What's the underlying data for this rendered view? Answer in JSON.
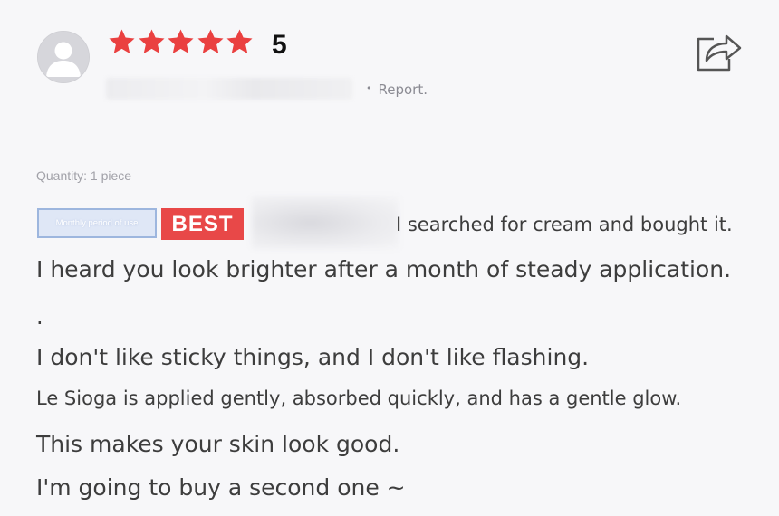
{
  "review": {
    "rating": "5",
    "stars": 5,
    "report_label": "Report.",
    "quantity": "Quantity: 1 piece",
    "period_badge": "Monthly period of use",
    "best_badge": "BEST",
    "lines": [
      "I searched for cream and bought it.",
      "I heard you look brighter after a month of steady application.",
      ".",
      "I don't like sticky things, and I don't like flashing.",
      "Le Sioga is applied gently, absorbed quickly, and has a gentle glow.",
      "This makes your skin look good.",
      "I'm going to buy a second one ~"
    ]
  },
  "icons": {
    "avatar": "default-user-avatar-icon",
    "star": "star-icon",
    "share": "share-icon"
  },
  "colors": {
    "star": "#ea4040",
    "best_badge": "#e84848",
    "period_badge_border": "#9db6de"
  }
}
